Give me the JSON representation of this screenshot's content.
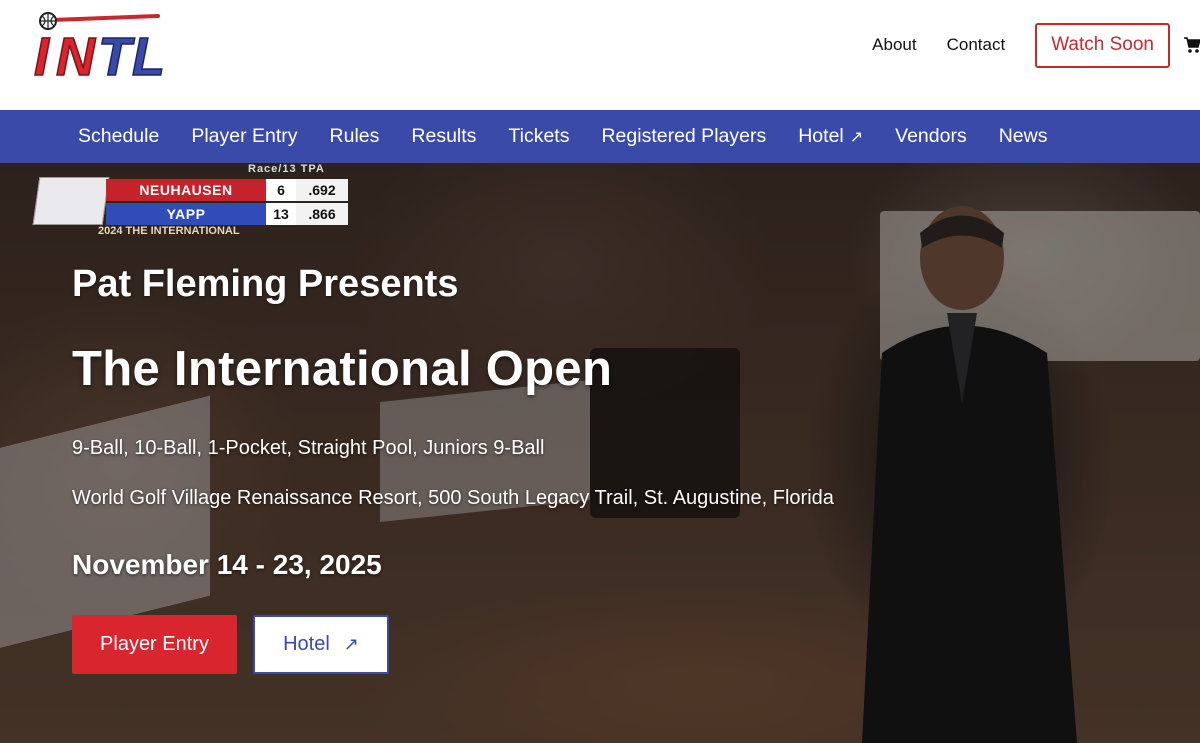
{
  "header": {
    "logo_text": "INTL",
    "links": [
      {
        "label": "About"
      },
      {
        "label": "Contact"
      }
    ],
    "watch_label": "Watch Soon",
    "cart_icon": "cart-icon"
  },
  "nav": {
    "items": [
      {
        "label": "Schedule"
      },
      {
        "label": "Player Entry"
      },
      {
        "label": "Rules"
      },
      {
        "label": "Results"
      },
      {
        "label": "Tickets"
      },
      {
        "label": "Registered Players"
      },
      {
        "label": "Hotel",
        "icon": "external-arrow-icon",
        "glyph": "↗"
      },
      {
        "label": "Vendors"
      },
      {
        "label": "News"
      }
    ]
  },
  "hero": {
    "scoreboard": {
      "header": "Race/13   TPA",
      "rows": [
        {
          "name": "NEUHAUSEN",
          "race": "6",
          "tpa": ".692"
        },
        {
          "name": "YAPP",
          "race": "13",
          "tpa": ".866"
        }
      ],
      "footer": "2024 THE INTERNATIONAL"
    },
    "presents": "Pat Fleming Presents",
    "title": "The International Open",
    "games": "9-Ball, 10-Ball, 1-Pocket, Straight Pool, Juniors 9-Ball",
    "venue": "World Golf Village Renaissance Resort, 500 South Legacy Trail, St. Augustine, Florida",
    "dates": "November 14 - 23, 2025",
    "buttons": {
      "entry_label": "Player Entry",
      "hotel_label": "Hotel",
      "hotel_glyph": "↗"
    }
  },
  "colors": {
    "nav_bg": "#3a4aa9",
    "brand_red": "#d9252d",
    "watch_red": "#c8282f"
  }
}
